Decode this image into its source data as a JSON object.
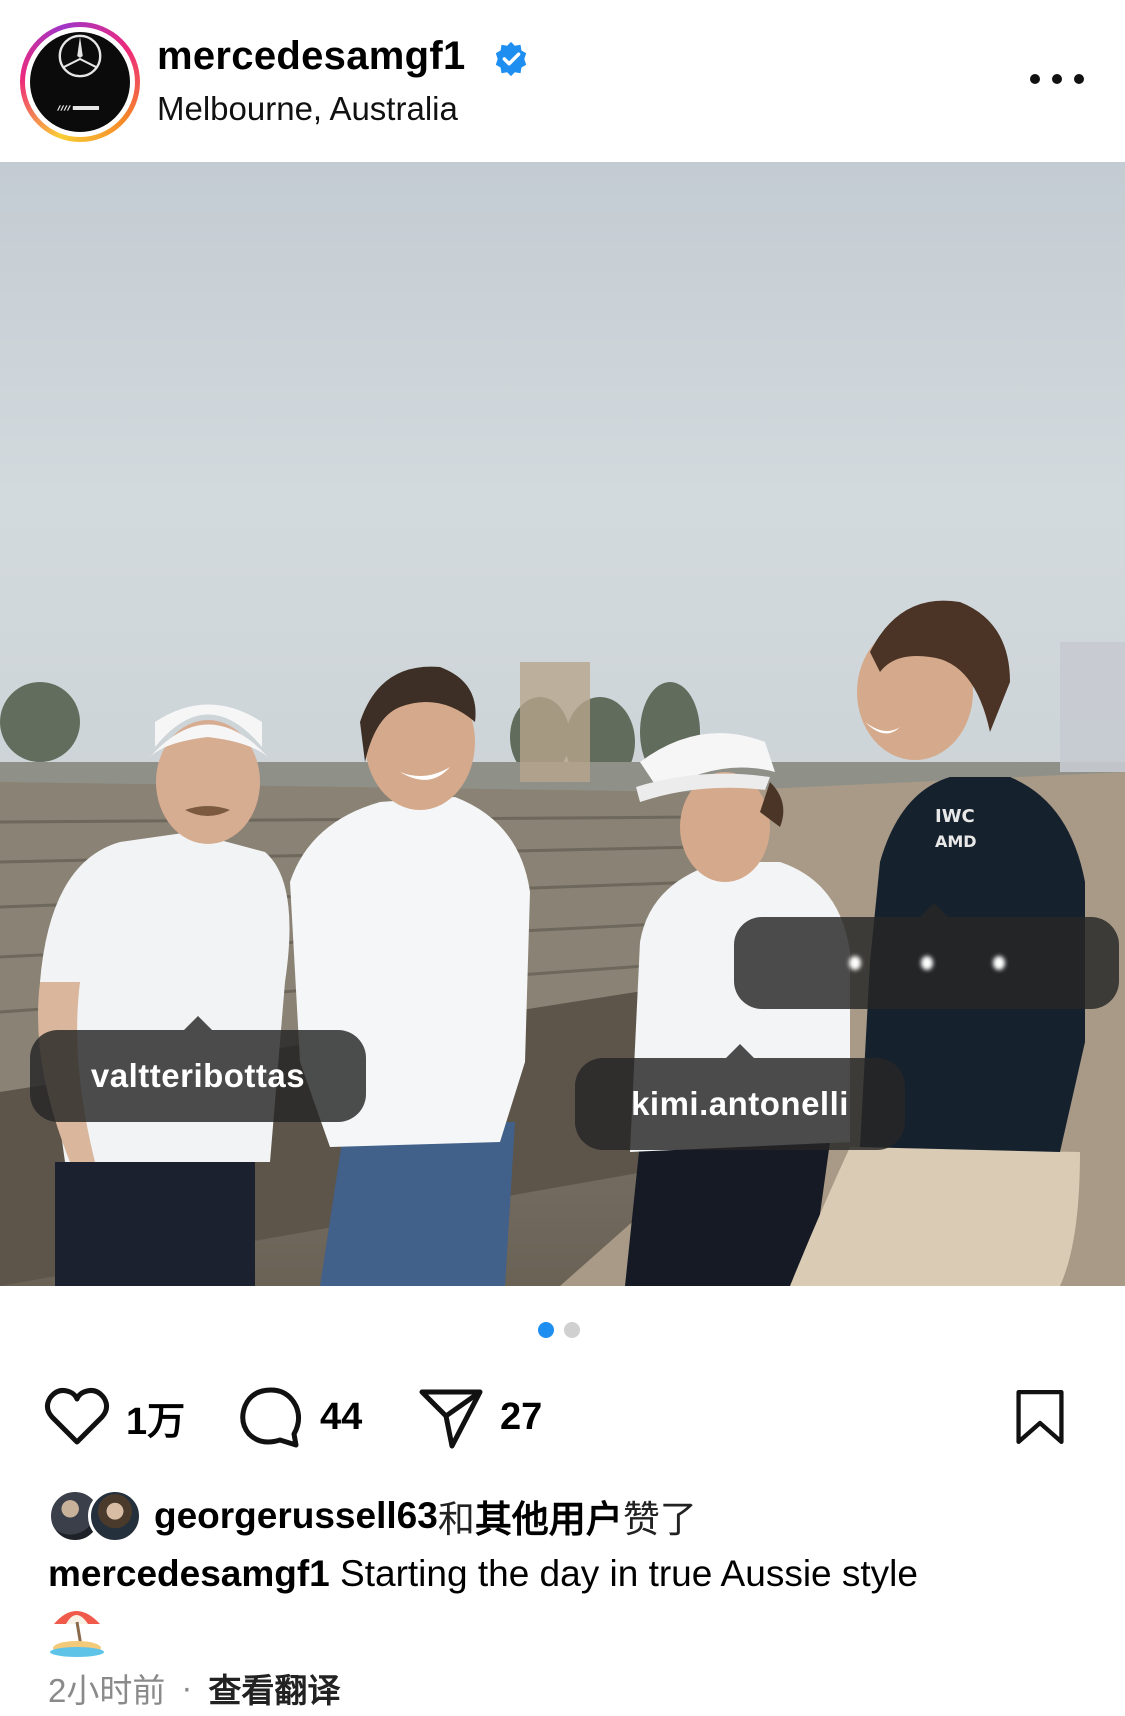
{
  "header": {
    "username": "mercedesamgf1",
    "location": "Melbourne, Australia",
    "verified": true
  },
  "photo": {
    "tags": {
      "valtteri": "valtteribottas",
      "kimi": "kimi.antonelli",
      "george": ""
    },
    "people_icon": "person-icon"
  },
  "carousel": {
    "total": 2,
    "active": 1
  },
  "actions": {
    "likes": "1万",
    "comments": "44",
    "shares": "27"
  },
  "liked_by": {
    "user": "georgerussell63",
    "connector": "和",
    "others": "其他用户",
    "suffix": "赞了"
  },
  "caption": {
    "username": "mercedesamgf1",
    "text": "Starting the day in true Aussie style"
  },
  "meta": {
    "time": "2小时前",
    "separator": "·",
    "translate": "查看翻译"
  },
  "colors": {
    "accent_blue": "#1f8ef1",
    "tag_bg": "#262626",
    "text_secondary": "#8a8a8a"
  }
}
